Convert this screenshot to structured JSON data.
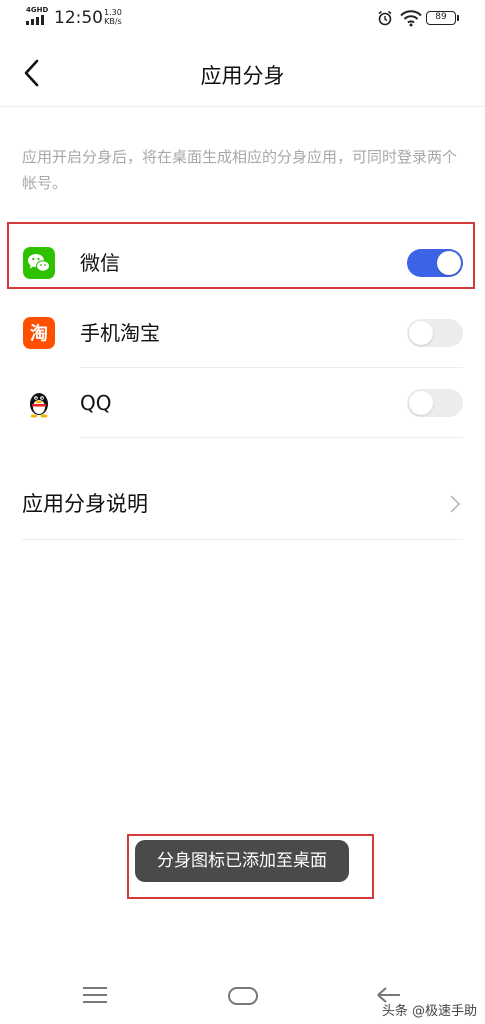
{
  "status_bar": {
    "network": "4GHD",
    "time": "12:50",
    "speed_value": "1.30",
    "speed_unit": "KB/s",
    "battery": "89"
  },
  "header": {
    "title": "应用分身"
  },
  "description": "应用开启分身后，将在桌面生成相应的分身应用，可同时登录两个帐号。",
  "apps": [
    {
      "label": "微信",
      "icon": "wechat-icon",
      "enabled": true,
      "color": "#2dc100"
    },
    {
      "label": "手机淘宝",
      "icon": "taobao-icon",
      "enabled": false,
      "color": "#ff5000"
    },
    {
      "label": "QQ",
      "icon": "qq-penguin-icon",
      "enabled": false,
      "color": "#000000"
    }
  ],
  "help": {
    "label": "应用分身说明"
  },
  "toast": "分身图标已添加至桌面",
  "watermark": "头条 @极速手助",
  "colors": {
    "accent": "#3d63e6",
    "highlight": "#d43a3a"
  }
}
